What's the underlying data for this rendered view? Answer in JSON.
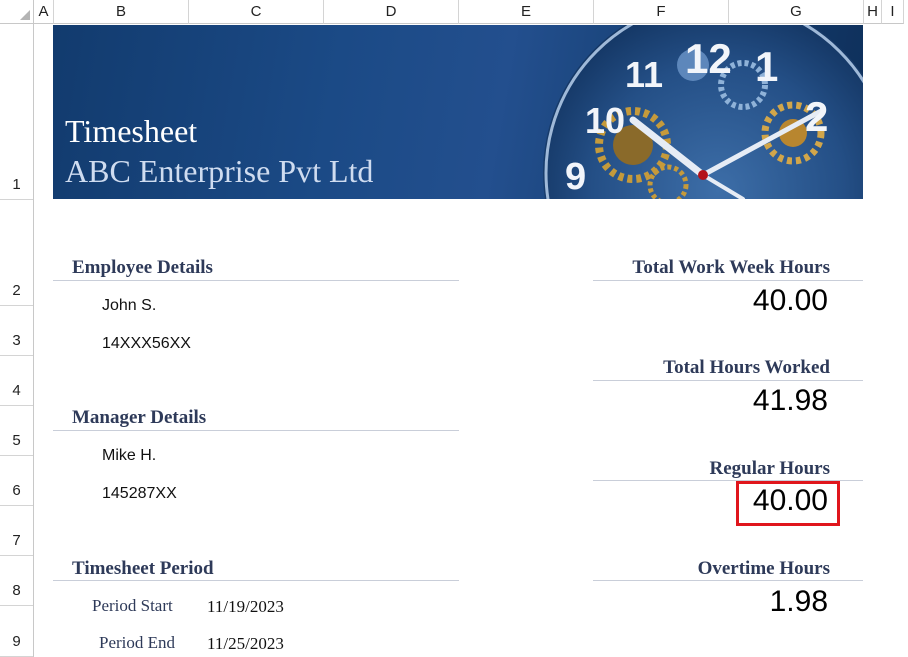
{
  "columns": [
    "A",
    "B",
    "C",
    "D",
    "E",
    "F",
    "G",
    "H",
    "I"
  ],
  "rows": [
    "1",
    "2",
    "3",
    "4",
    "5",
    "6",
    "7",
    "8",
    "9"
  ],
  "banner": {
    "title": "Timesheet",
    "subtitle": "ABC Enterprise Pvt Ltd",
    "clock_numbers": [
      "12",
      "11",
      "10",
      "9",
      "2",
      "1"
    ]
  },
  "employee": {
    "heading": "Employee Details",
    "name": "John S.",
    "id": "14XXX56XX"
  },
  "manager": {
    "heading": "Manager Details",
    "name": "Mike H.",
    "id": "145287XX"
  },
  "period": {
    "heading": "Timesheet Period",
    "start_label": "Period Start",
    "start_value": "11/19/2023",
    "end_label": "Period End",
    "end_value": "11/25/2023"
  },
  "summary": {
    "work_week_label": "Total Work Week Hours",
    "work_week_value": "40.00",
    "worked_label": "Total Hours Worked",
    "worked_value": "41.98",
    "regular_label": "Regular Hours",
    "regular_value": "40.00",
    "overtime_label": "Overtime Hours",
    "overtime_value": "1.98"
  },
  "colors": {
    "banner": "#1b4a86",
    "heading": "#2e3a59",
    "highlight": "#e0161c"
  }
}
